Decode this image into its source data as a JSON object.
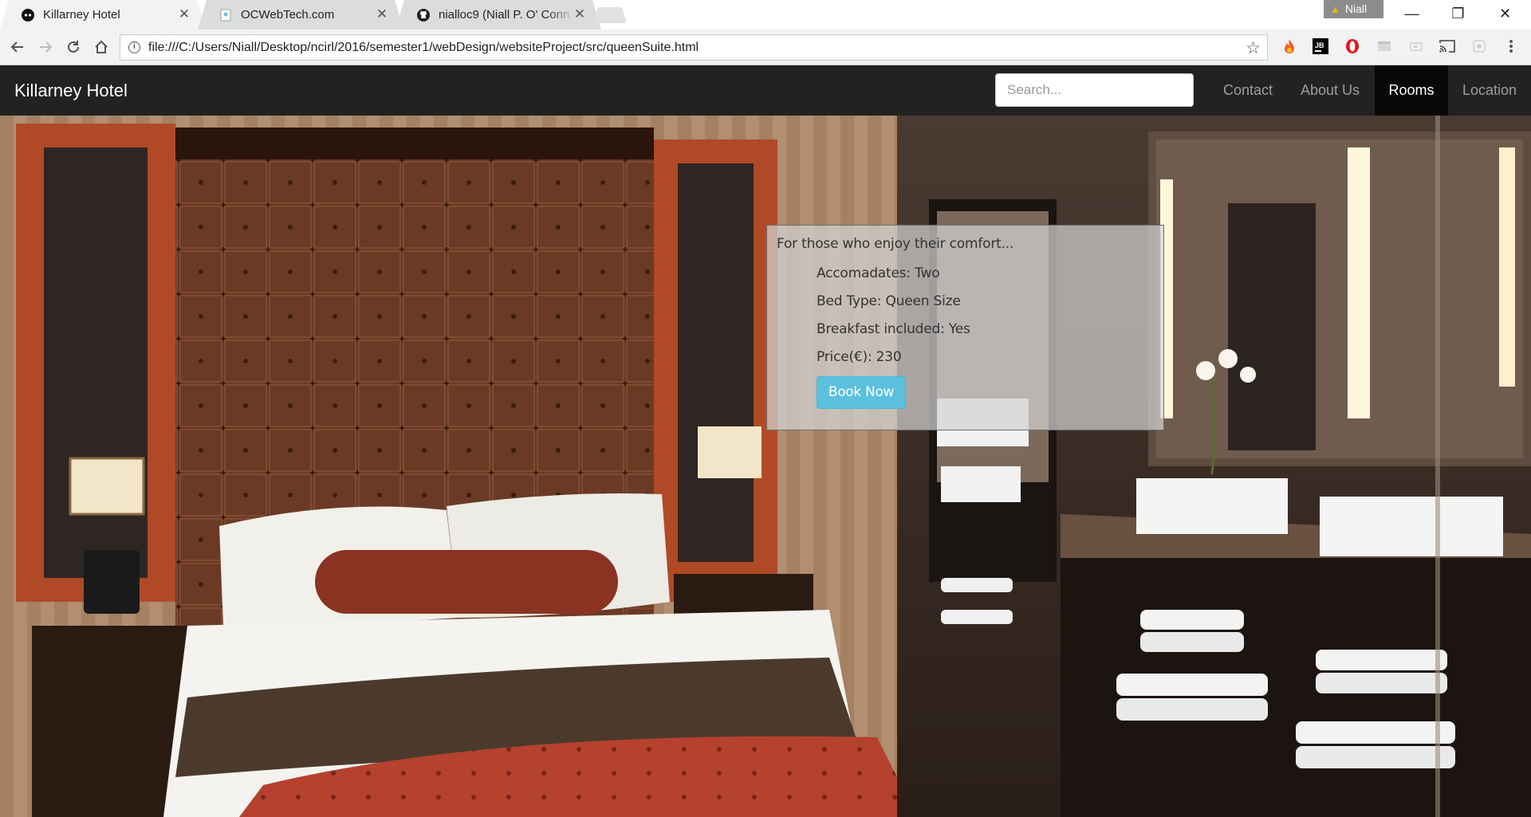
{
  "browser": {
    "tabs": [
      {
        "title": "Killarney Hotel",
        "icon": "site-favicon",
        "active": true
      },
      {
        "title": "OCWebTech.com",
        "icon": "page-icon",
        "active": false
      },
      {
        "title": "nialloc9 (Niall P. O' Conn",
        "icon": "github-icon",
        "active": false
      }
    ],
    "close_glyph": "✕",
    "profile_name": "Niall",
    "url": "file:///C:/Users/Niall/Desktop/ncirl/2016/semester1/webDesign/websiteProject/src/queenSuite.html",
    "window_controls": {
      "minimize": "—",
      "restore": "❐",
      "close": "✕"
    }
  },
  "site": {
    "brand": "Killarney Hotel",
    "search_placeholder": "Search...",
    "nav": [
      {
        "label": "Contact",
        "active": false
      },
      {
        "label": "About Us",
        "active": false
      },
      {
        "label": "Rooms",
        "active": true
      },
      {
        "label": "Location",
        "active": false
      }
    ]
  },
  "room": {
    "tagline": "For those who enjoy their comfort...",
    "accommodates": "Accomadates: Two",
    "bed_type": "Bed Type: Queen Size",
    "breakfast": "Breakfast included: Yes",
    "price": "Price(€): 230",
    "book_label": "Book Now"
  },
  "colors": {
    "navbar": "#222222",
    "nav_active": "#080808",
    "book_button": "#5bc0de"
  }
}
